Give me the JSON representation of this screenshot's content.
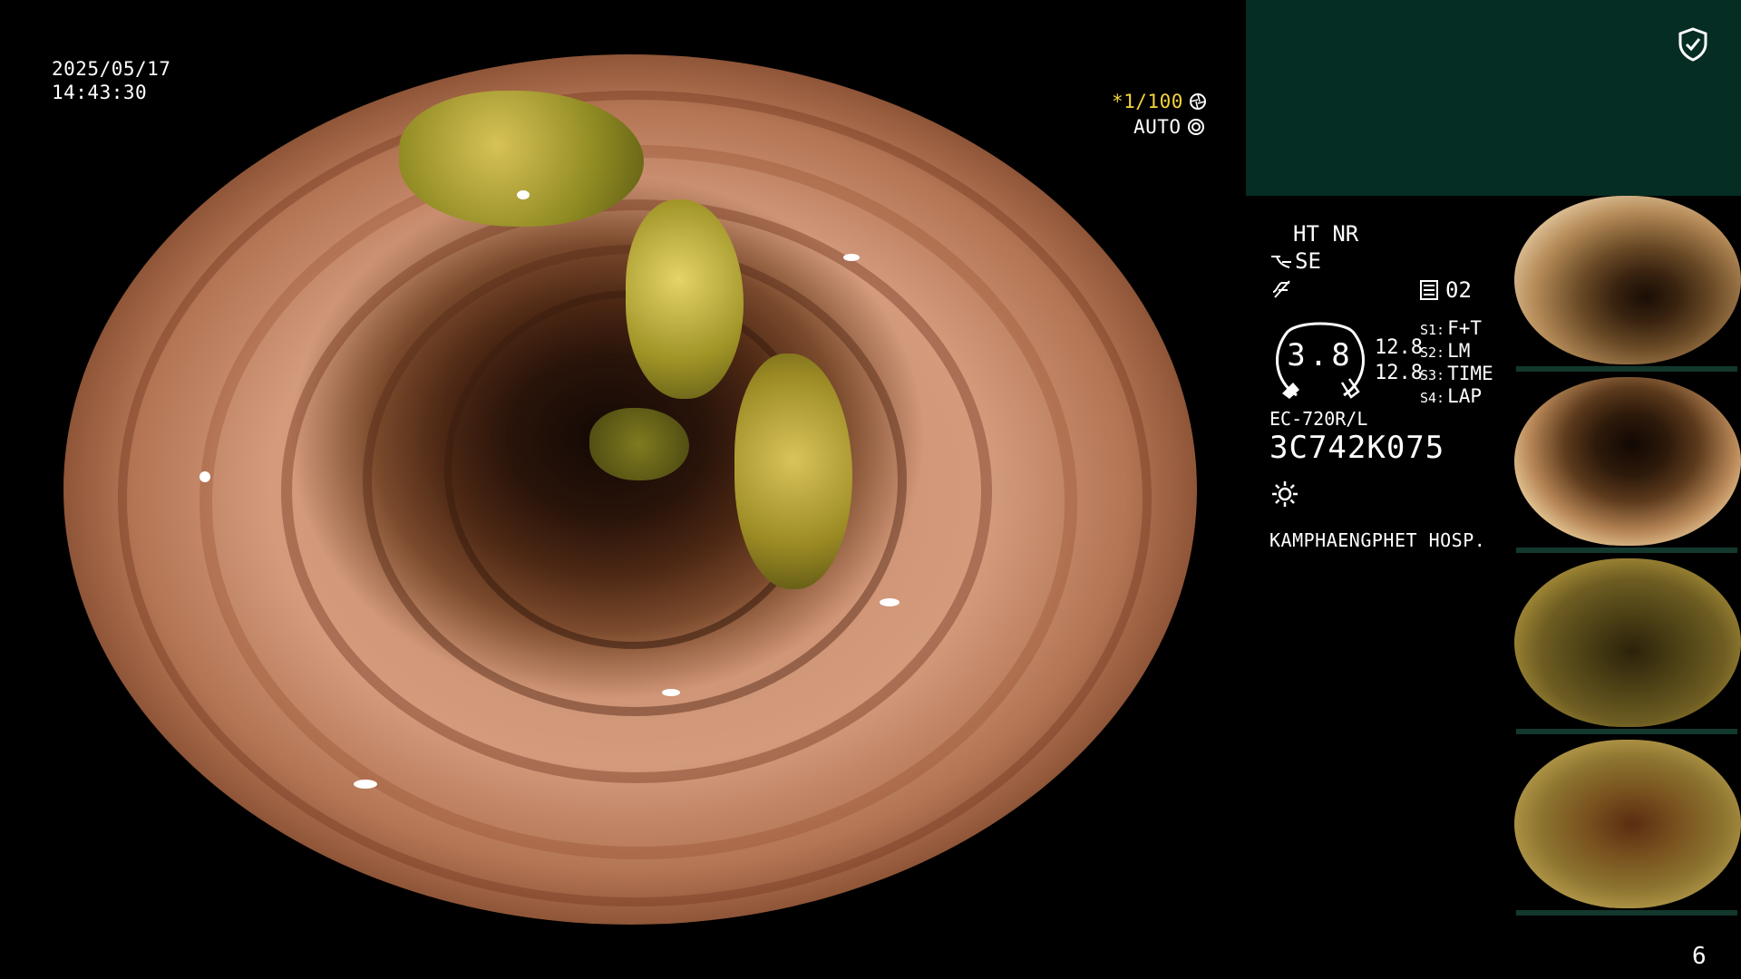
{
  "overlay": {
    "date": "2025/05/17",
    "time": "14:43:30",
    "shutter": "*1/100",
    "shutter_icon": "aperture-icon",
    "exposure_mode": "AUTO",
    "exposure_icon": "iris-icon"
  },
  "panel": {
    "shield_icon": "shield-check-icon",
    "ht_nr": "HT NR",
    "se_label": "SE",
    "channel_icon": "frame-icon",
    "channel_value": "02",
    "gauge_value": "3.8",
    "gauge_side_top": "12.8",
    "gauge_side_bottom": "12.8",
    "scopes": [
      {
        "key": "S1:",
        "value": "F+T"
      },
      {
        "key": "S2:",
        "value": "LM"
      },
      {
        "key": "S3:",
        "value": "TIME"
      },
      {
        "key": "S4:",
        "value": "LAP"
      }
    ],
    "scope_model": "EC-720R/L",
    "scope_serial": "3C742K075",
    "light_icon": "light-source-icon",
    "hospital": "KAMPHAENGPHET HOSP."
  },
  "page_number": "6",
  "colors": {
    "panel_bg": "#062d24",
    "accent_yellow": "#f5d33a",
    "thumb_bar": "#13382e"
  }
}
